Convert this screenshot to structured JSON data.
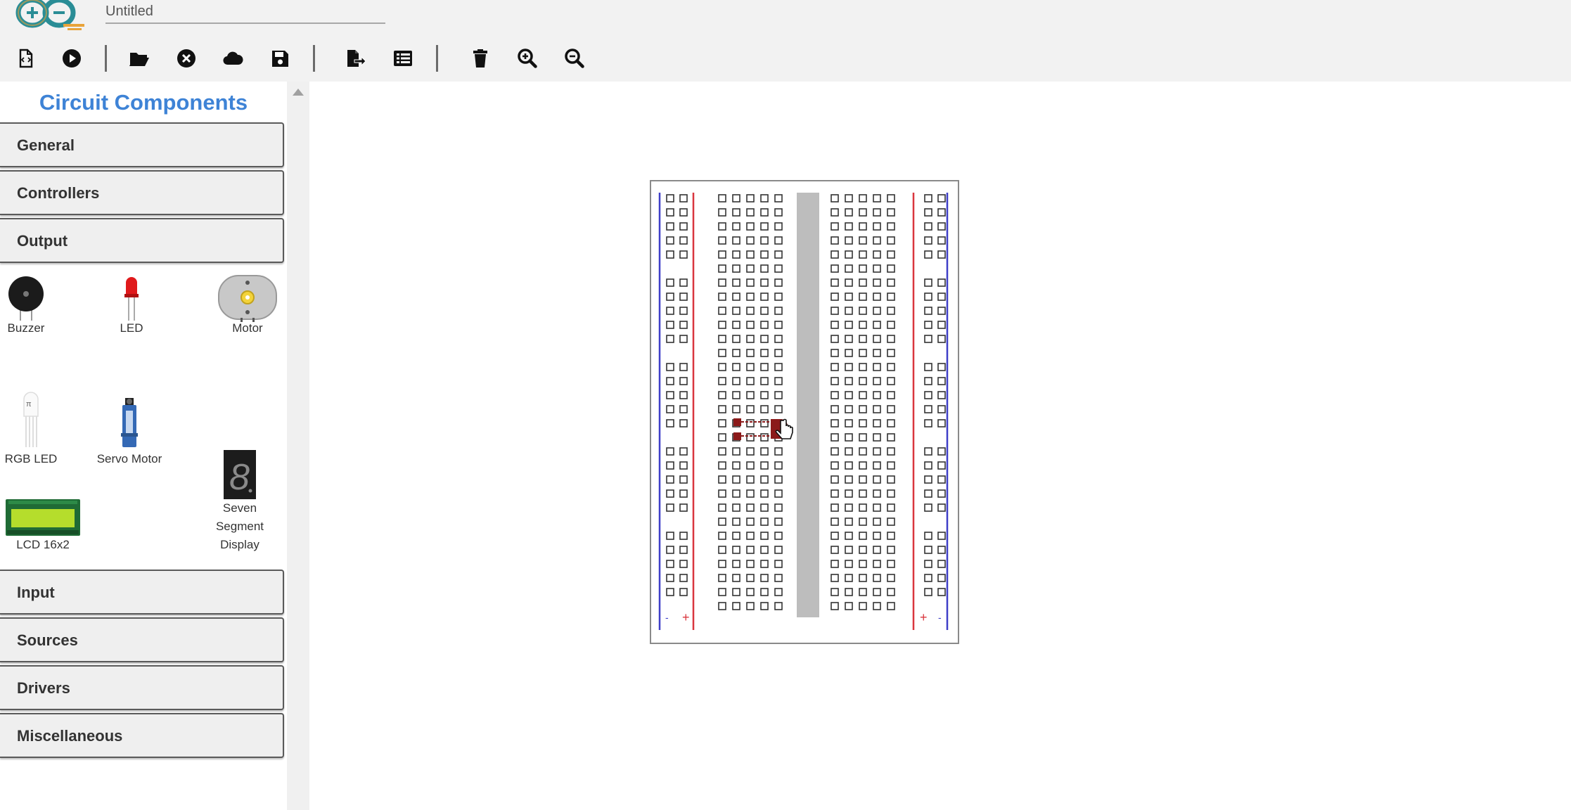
{
  "app": {
    "project_title": "Untitled"
  },
  "toolbar": {
    "buttons": [
      {
        "name": "new-file-button",
        "icon": "new-file-icon"
      },
      {
        "name": "run-simulation-button",
        "icon": "play-circle-icon"
      },
      {
        "name": "open-folder-button",
        "icon": "folder-open-icon"
      },
      {
        "name": "close-button",
        "icon": "close-circle-icon"
      },
      {
        "name": "cloud-button",
        "icon": "cloud-icon"
      },
      {
        "name": "save-button",
        "icon": "floppy-disk-icon"
      },
      {
        "name": "export-button",
        "icon": "file-export-icon"
      },
      {
        "name": "list-button",
        "icon": "list-icon"
      },
      {
        "name": "delete-button",
        "icon": "trash-icon"
      },
      {
        "name": "zoom-in-button",
        "icon": "zoom-in-icon"
      },
      {
        "name": "zoom-out-button",
        "icon": "zoom-out-icon"
      }
    ]
  },
  "sidebar": {
    "title": "Circuit Components",
    "categories": {
      "general": "General",
      "controllers": "Controllers",
      "output": "Output",
      "input": "Input",
      "sources": "Sources",
      "drivers": "Drivers",
      "misc": "Miscellaneous"
    },
    "output_components": {
      "buzzer": "Buzzer",
      "led": "LED",
      "motor": "Motor",
      "rgb_led": "RGB LED",
      "servo": "Servo Motor",
      "seven_segment_1": "Seven",
      "seven_segment_2": "Segment",
      "seven_segment_3": "Display",
      "lcd": "LCD 16x2"
    }
  },
  "colors": {
    "accent_title": "#3e83d6",
    "rail_red": "#d9363e",
    "rail_blue": "#3f3fc8",
    "led_dark_red": "#8b1a1a"
  }
}
